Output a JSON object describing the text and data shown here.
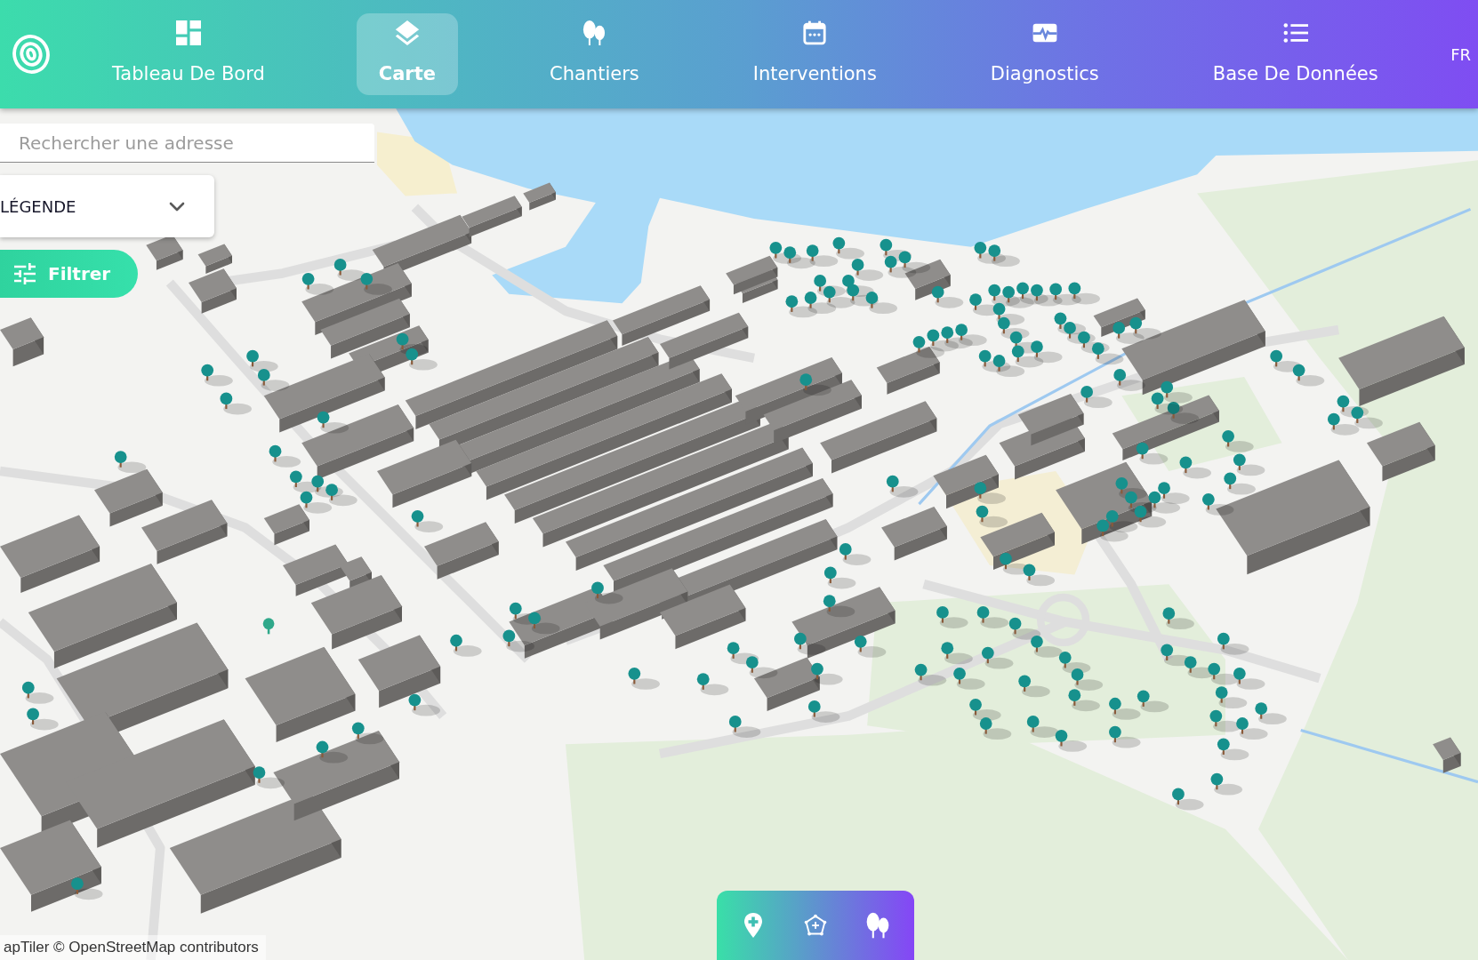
{
  "header": {
    "nav": [
      {
        "label": "Tableau De Bord",
        "selected": false
      },
      {
        "label": "Carte",
        "selected": true
      },
      {
        "label": "Chantiers",
        "selected": false
      },
      {
        "label": "Interventions",
        "selected": false
      },
      {
        "label": "Diagnostics",
        "selected": false
      },
      {
        "label": "Base De Données",
        "selected": false
      }
    ],
    "language": "FR"
  },
  "search": {
    "placeholder": "Rechercher une adresse"
  },
  "legend": {
    "title": "LÉGENDE",
    "expanded": false
  },
  "filter_button": {
    "label": "Filtrer"
  },
  "map": {
    "attribution": "apTiler © OpenStreetMap contributors"
  }
}
